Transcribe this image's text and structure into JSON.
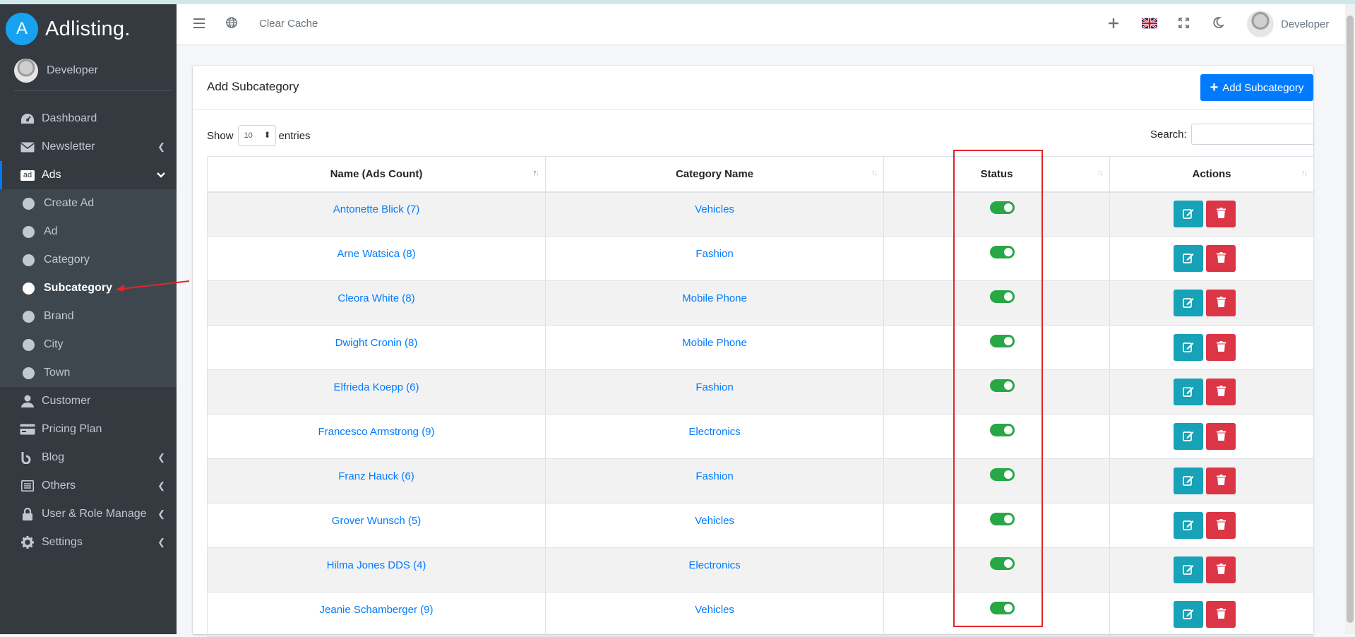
{
  "app": {
    "brand_initial": "A",
    "brand_name": "Adlisting."
  },
  "sidebar": {
    "user_name": "Developer",
    "items": [
      {
        "label": "Dashboard",
        "icon": "dashboard-icon"
      },
      {
        "label": "Newsletter",
        "icon": "envelope-icon",
        "has_children": true
      },
      {
        "label": "Ads",
        "icon": "ad-icon",
        "open": true
      }
    ],
    "ads_children": [
      "Create Ad",
      "Ad",
      "Category",
      "Subcategory",
      "Brand",
      "City",
      "Town"
    ],
    "active_child": "Subcategory",
    "bottom_items": [
      {
        "label": "Customer",
        "icon": "user-icon"
      },
      {
        "label": "Pricing Plan",
        "icon": "pricing-icon"
      },
      {
        "label": "Blog",
        "icon": "blog-icon",
        "has_children": true
      },
      {
        "label": "Others",
        "icon": "list-icon",
        "has_children": true
      },
      {
        "label": "User & Role Manage",
        "icon": "lock-icon",
        "has_children": true
      },
      {
        "label": "Settings",
        "icon": "gear-icon",
        "has_children": true
      }
    ]
  },
  "topbar": {
    "clear_cache": "Clear Cache",
    "user_name": "Developer"
  },
  "card": {
    "title": "Add Subcategory",
    "add_button": "Add Subcategory",
    "show_label": "Show",
    "entries_label": "entries",
    "page_size": "10",
    "search_label": "Search:"
  },
  "table": {
    "columns": [
      "Name (Ads Count)",
      "Category Name",
      "Status",
      "Actions"
    ],
    "rows": [
      {
        "name": "Antonette Blick (7)",
        "category": "Vehicles",
        "status": "on"
      },
      {
        "name": "Arne Watsica (8)",
        "category": "Fashion",
        "status": "on"
      },
      {
        "name": "Cleora White (8)",
        "category": "Mobile Phone",
        "status": "on"
      },
      {
        "name": "Dwight Cronin (8)",
        "category": "Mobile Phone",
        "status": "on"
      },
      {
        "name": "Elfrieda Koepp (6)",
        "category": "Fashion",
        "status": "on"
      },
      {
        "name": "Francesco Armstrong (9)",
        "category": "Electronics",
        "status": "on"
      },
      {
        "name": "Franz Hauck (6)",
        "category": "Fashion",
        "status": "on"
      },
      {
        "name": "Grover Wunsch (5)",
        "category": "Vehicles",
        "status": "on"
      },
      {
        "name": "Hilma Jones DDS (4)",
        "category": "Electronics",
        "status": "on"
      },
      {
        "name": "Jeanie Schamberger (9)",
        "category": "Vehicles",
        "status": "on"
      }
    ]
  },
  "colors": {
    "sidebar_bg": "#343a40",
    "primary": "#007bff",
    "edit_button": "#17a2b8",
    "delete_button": "#dc3545",
    "toggle_on": "#28a745",
    "annotation_red": "#e2262c"
  }
}
